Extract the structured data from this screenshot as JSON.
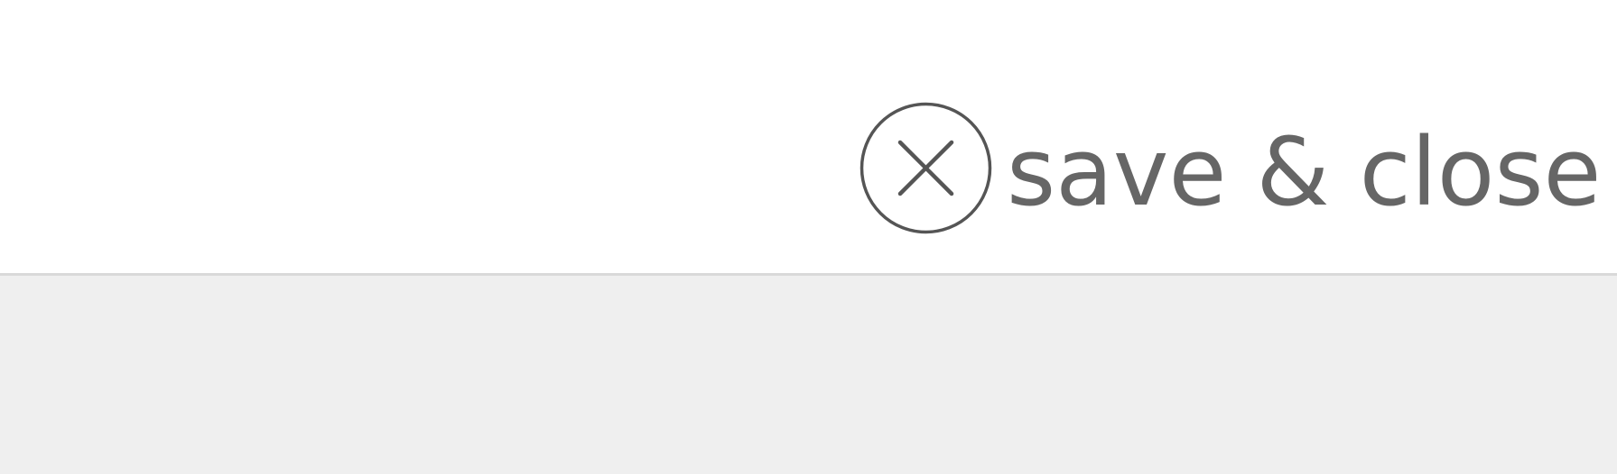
{
  "header": {
    "save_close_label": "save & close",
    "close_icon": "circle-x-icon"
  },
  "colors": {
    "header_background": "#ffffff",
    "content_background": "#efefef",
    "divider": "#d9d9d9",
    "text": "#666666",
    "icon": "#555555"
  }
}
